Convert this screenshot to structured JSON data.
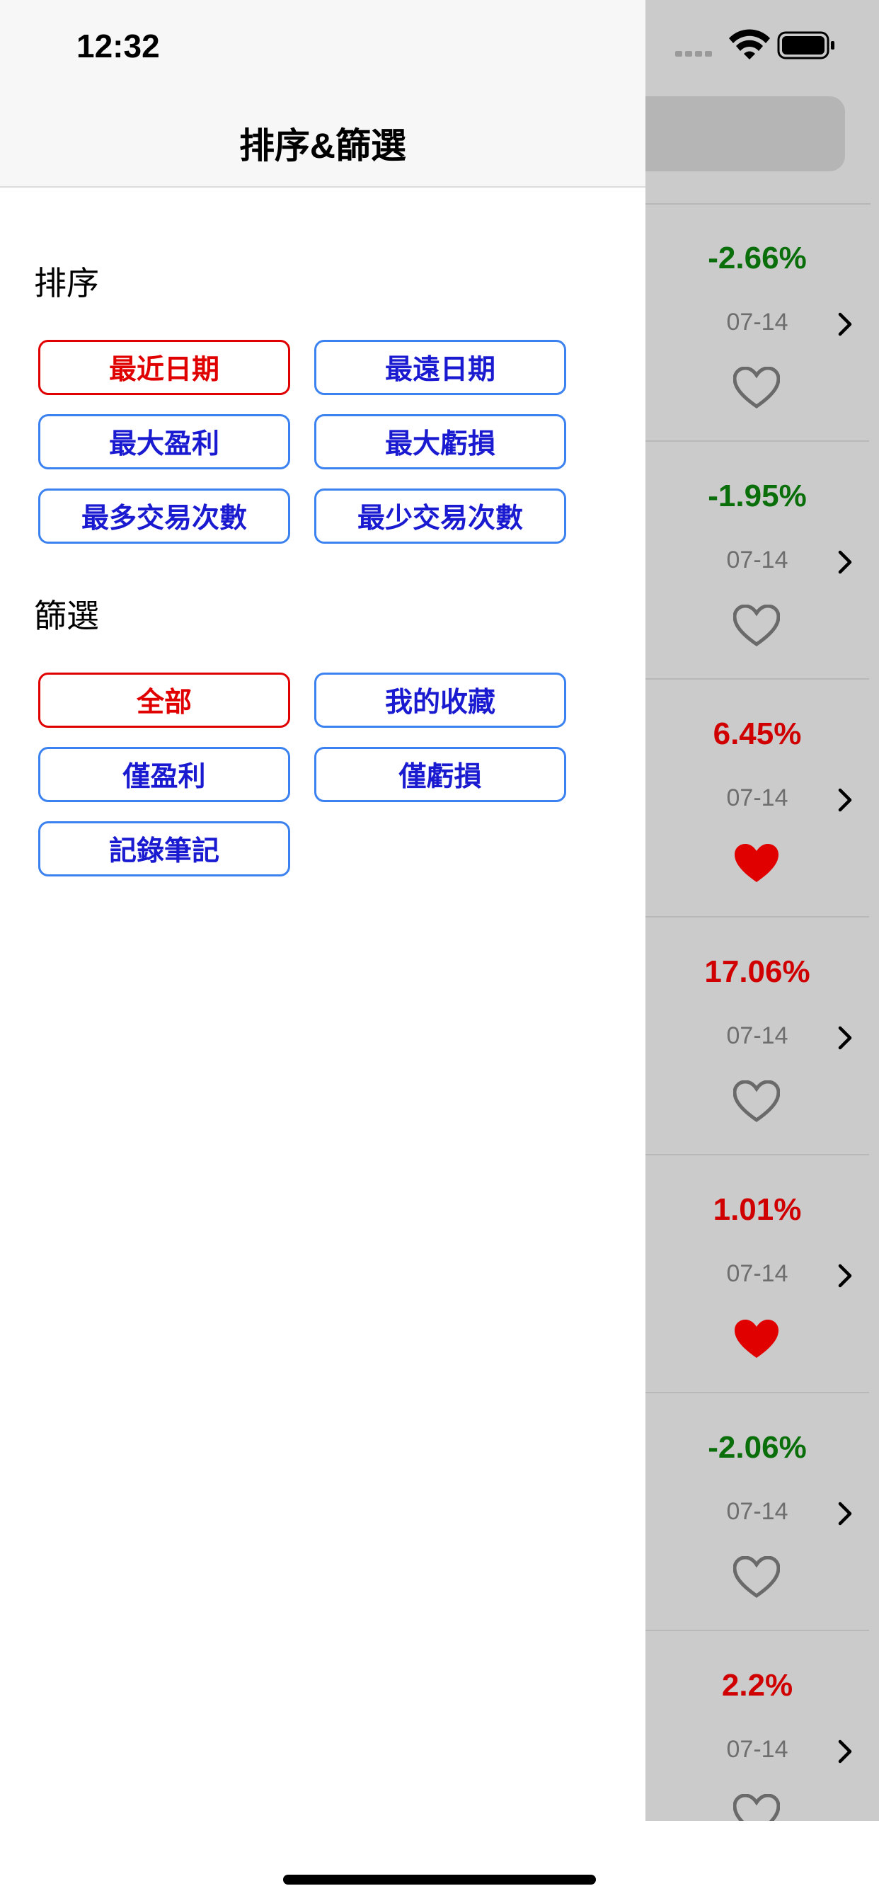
{
  "status_bar": {
    "time": "12:32"
  },
  "drawer": {
    "title": "排序&篩選",
    "sort": {
      "label": "排序",
      "buttons": [
        "最近日期",
        "最遠日期",
        "最大盈利",
        "最大虧損",
        "最多交易次數",
        "最少交易次數"
      ],
      "selected": "最近日期"
    },
    "filter": {
      "label": "篩選",
      "buttons": [
        "全部",
        "我的收藏",
        "僅盈利",
        "僅虧損",
        "記錄筆記"
      ],
      "selected": "全部"
    }
  },
  "list": {
    "items": [
      {
        "pct": "-2.66%",
        "date": "07-14",
        "favorite": false,
        "tone": "loss"
      },
      {
        "pct": "-1.95%",
        "date": "07-14",
        "favorite": false,
        "tone": "loss"
      },
      {
        "pct": "6.45%",
        "date": "07-14",
        "favorite": true,
        "tone": "gain"
      },
      {
        "pct": "17.06%",
        "date": "07-14",
        "favorite": false,
        "tone": "gain"
      },
      {
        "pct": "1.01%",
        "date": "07-14",
        "favorite": true,
        "tone": "gain"
      },
      {
        "pct": "-2.06%",
        "date": "07-14",
        "favorite": false,
        "tone": "loss"
      },
      {
        "pct": "2.2%",
        "date": "07-14",
        "favorite": false,
        "tone": "gain"
      }
    ]
  },
  "colors": {
    "gain": "#d00000",
    "loss": "#0a6e0a",
    "accent_active": "#e00000",
    "button_text": "#1a1ad0",
    "button_border": "#3b82f0"
  }
}
